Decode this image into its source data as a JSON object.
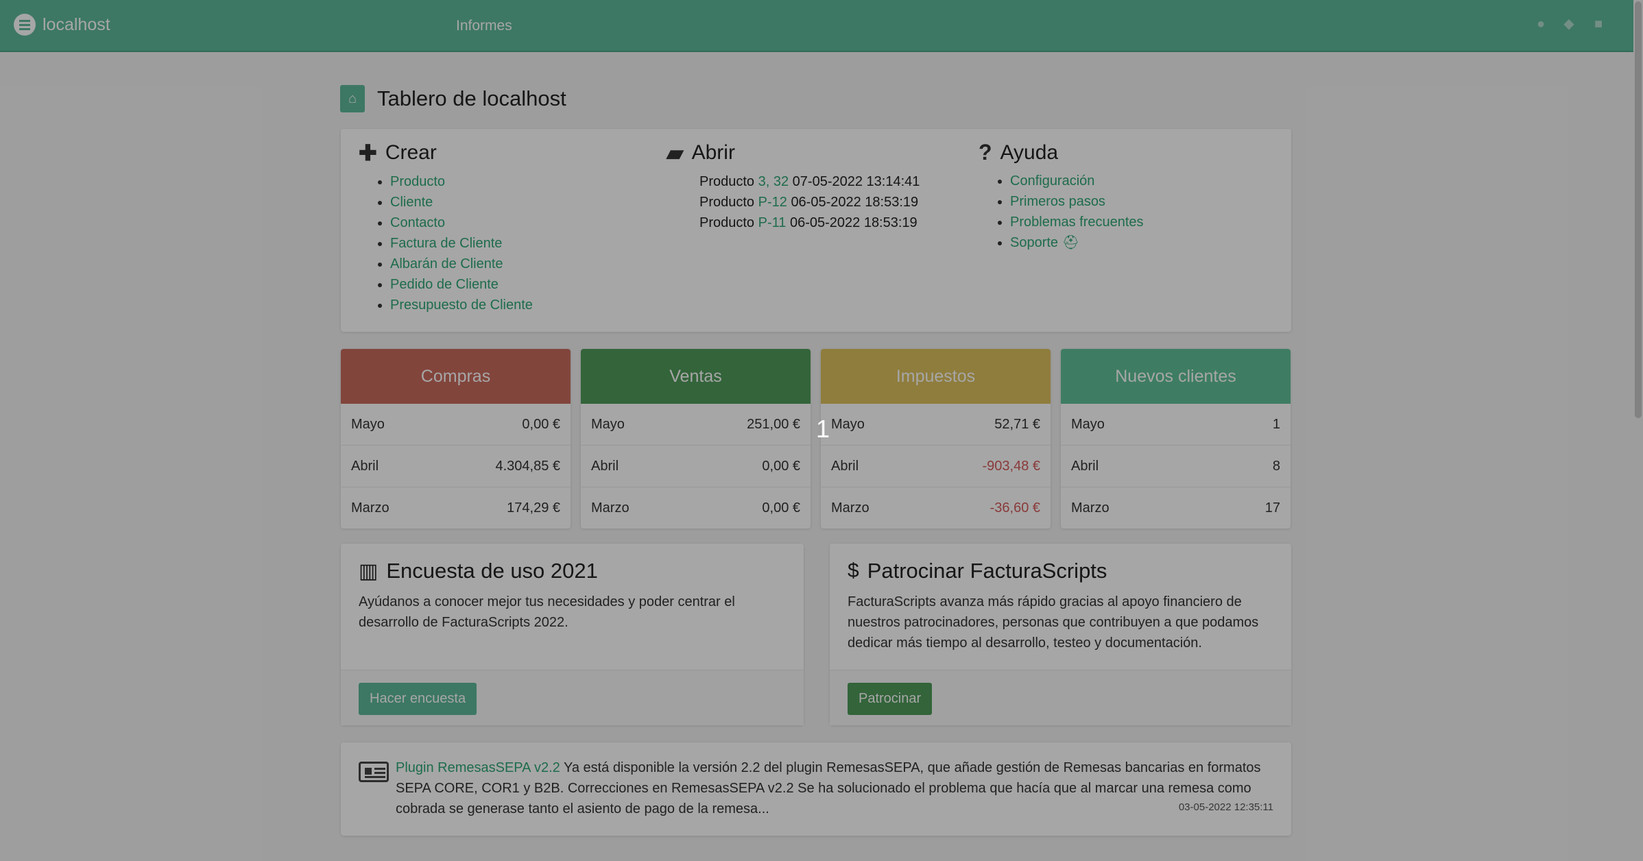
{
  "navbar": {
    "brand": "localhost",
    "menu_item": "Informes",
    "icons": [
      "user-icon",
      "bell-icon",
      "settings-icon"
    ]
  },
  "page": {
    "title": "Tablero de localhost"
  },
  "create": {
    "title": "Crear",
    "items": [
      "Producto",
      "Cliente",
      "Contacto",
      "Factura de Cliente",
      "Albarán de Cliente",
      "Pedido de Cliente",
      "Presupuesto de Cliente"
    ]
  },
  "open": {
    "title": "Abrir",
    "items": [
      {
        "type": "Producto",
        "ref": "3, 32",
        "date": "07-05-2022 13:14:41"
      },
      {
        "type": "Producto",
        "ref": "P-12",
        "date": "06-05-2022 18:53:19"
      },
      {
        "type": "Producto",
        "ref": "P-11",
        "date": "06-05-2022 18:53:19"
      }
    ]
  },
  "help": {
    "title": "Ayuda",
    "items": [
      "Configuración",
      "Primeros pasos",
      "Problemas frecuentes",
      "Soporte"
    ]
  },
  "stats": [
    {
      "title": "Compras",
      "color": "#c86a5d",
      "rows": [
        {
          "month": "Mayo",
          "value": "0,00 €"
        },
        {
          "month": "Abril",
          "value": "4.304,85 €"
        },
        {
          "month": "Marzo",
          "value": "174,29 €"
        }
      ]
    },
    {
      "title": "Ventas",
      "color": "#4f9a5a",
      "rows": [
        {
          "month": "Mayo",
          "value": "251,00 €"
        },
        {
          "month": "Abril",
          "value": "0,00 €"
        },
        {
          "month": "Marzo",
          "value": "0,00 €"
        }
      ]
    },
    {
      "title": "Impuestos",
      "color": "#dcc15f",
      "rows": [
        {
          "month": "Mayo",
          "value": "52,71 €"
        },
        {
          "month": "Abril",
          "value": "-903,48 €"
        },
        {
          "month": "Marzo",
          "value": "-36,60 €"
        }
      ]
    },
    {
      "title": "Nuevos clientes",
      "color": "#60c099",
      "rows": [
        {
          "month": "Mayo",
          "value": "1"
        },
        {
          "month": "Abril",
          "value": "8"
        },
        {
          "month": "Marzo",
          "value": "17"
        }
      ]
    }
  ],
  "survey": {
    "title": "Encuesta de uso 2021",
    "text": "Ayúdanos a conocer mejor tus necesidades y poder centrar el desarrollo de FacturaScripts 2022.",
    "button": "Hacer encuesta",
    "button_color": "#5fb89a"
  },
  "sponsor": {
    "title": "Patrocinar FacturaScripts",
    "text": "FacturaScripts avanza más rápido gracias al apoyo financiero de nuestros patrocinadores, personas que contribuyen a que podamos dedicar más tiempo al desarrollo, testeo y documentación.",
    "button": "Patrocinar",
    "button_color": "#4f9a5a"
  },
  "news": {
    "link": "Plugin RemesasSEPA v2.2",
    "text": "Ya está disponible la versión 2.2 del plugin RemesasSEPA, que añade gestión de Remesas bancarias en formatos SEPA CORE, COR1 y B2B. Correcciones en RemesasSEPA v2.2 Se ha solucionado el problema que hacía que al marcar una remesa como cobrada se generase tanto el asiento de pago de la remesa...",
    "date": "03-05-2022 12:35:11"
  },
  "overlay": {
    "marker": "1"
  }
}
